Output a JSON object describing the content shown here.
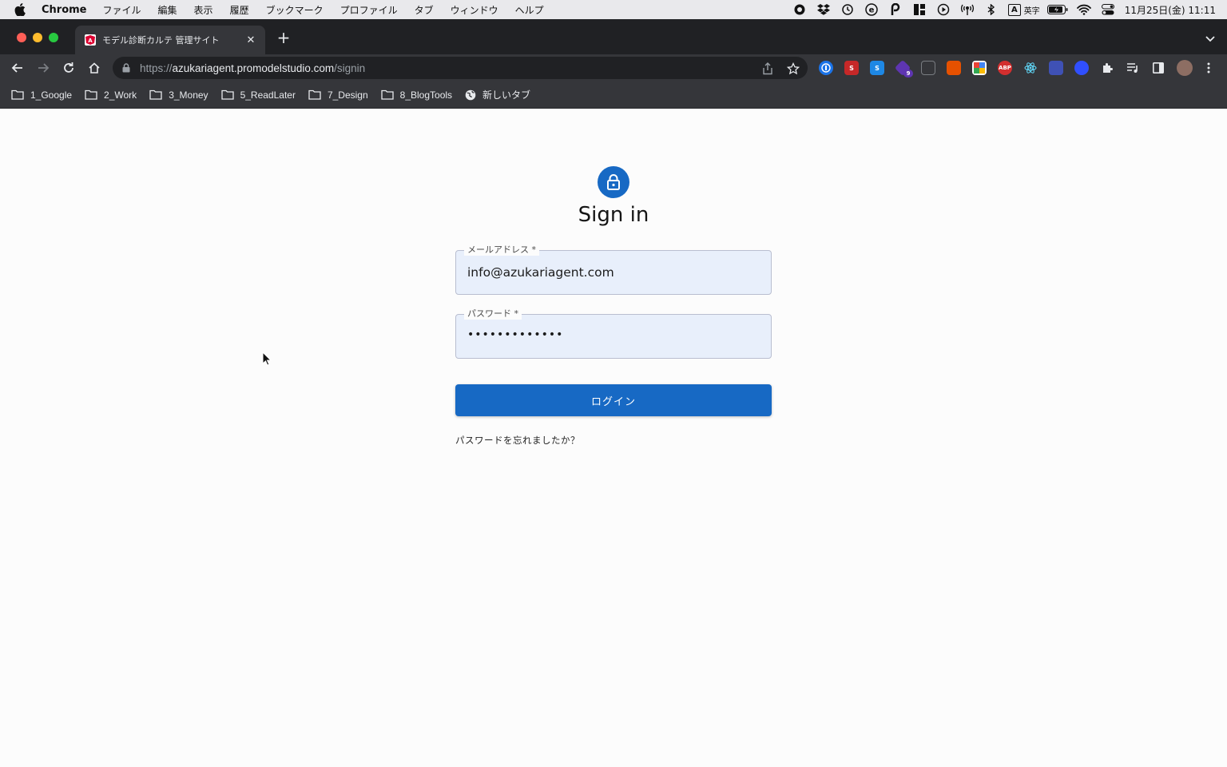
{
  "menubar": {
    "app_name": "Chrome",
    "items": [
      "ファイル",
      "編集",
      "表示",
      "履歴",
      "ブックマーク",
      "プロファイル",
      "タブ",
      "ウィンドウ",
      "ヘルプ"
    ],
    "input_mode_box": "A",
    "input_mode_label": "英字",
    "datetime": "11月25日(金)  11:11"
  },
  "tab": {
    "title": "モデル診断カルテ 管理サイト",
    "favicon_letter": "A"
  },
  "toolbar": {
    "url_scheme": "https://",
    "url_host": "azukariagent.promodelstudio.com",
    "url_path": "/signin",
    "extension_badge": "9"
  },
  "bookmarks": [
    "1_Google",
    "2_Work",
    "3_Money",
    "5_ReadLater",
    "7_Design",
    "8_BlogTools",
    "新しいタブ"
  ],
  "signin": {
    "title": "Sign in",
    "email_label": "メールアドレス *",
    "email_value": "info@azukariagent.com",
    "password_label": "パスワード *",
    "password_value": "•••••••••••••",
    "login_button": "ログイン",
    "forgot_link": "パスワードを忘れましたか？"
  },
  "colors": {
    "primary": "#1769c4",
    "autofill_bg": "#e8effb",
    "chrome_dark": "#202124",
    "chrome_toolbar": "#35363a"
  }
}
